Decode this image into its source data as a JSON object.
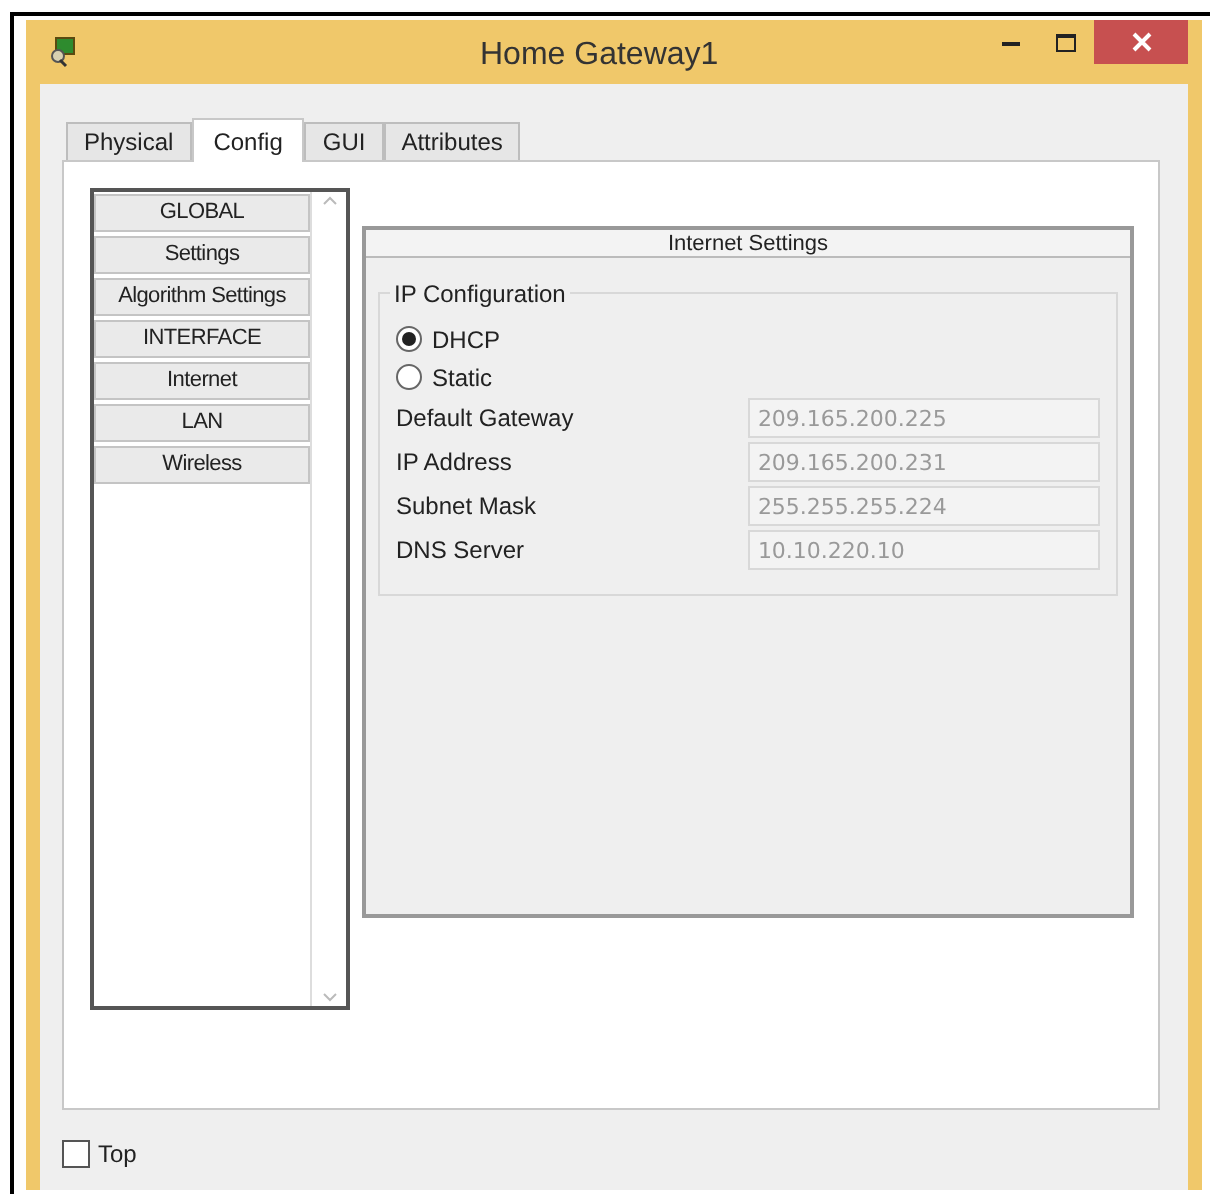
{
  "window": {
    "title": "Home Gateway1"
  },
  "tabs": [
    {
      "label": "Physical",
      "selected": false
    },
    {
      "label": "Config",
      "selected": true
    },
    {
      "label": "GUI",
      "selected": false
    },
    {
      "label": "Attributes",
      "selected": false
    }
  ],
  "sidebar": {
    "items": [
      {
        "label": "GLOBAL"
      },
      {
        "label": "Settings"
      },
      {
        "label": "Algorithm Settings"
      },
      {
        "label": "INTERFACE"
      },
      {
        "label": "Internet"
      },
      {
        "label": "LAN"
      },
      {
        "label": "Wireless"
      }
    ]
  },
  "panel": {
    "title": "Internet Settings",
    "group": "IP Configuration",
    "options": [
      {
        "label": "DHCP",
        "selected": true
      },
      {
        "label": "Static",
        "selected": false
      }
    ],
    "fields": [
      {
        "label": "Default Gateway",
        "value": "209.165.200.225"
      },
      {
        "label": "IP Address",
        "value": "209.165.200.231"
      },
      {
        "label": "Subnet Mask",
        "value": "255.255.255.224"
      },
      {
        "label": "DNS Server",
        "value": "10.10.220.10"
      }
    ]
  },
  "top_checkbox": {
    "label": "Top",
    "checked": false
  }
}
